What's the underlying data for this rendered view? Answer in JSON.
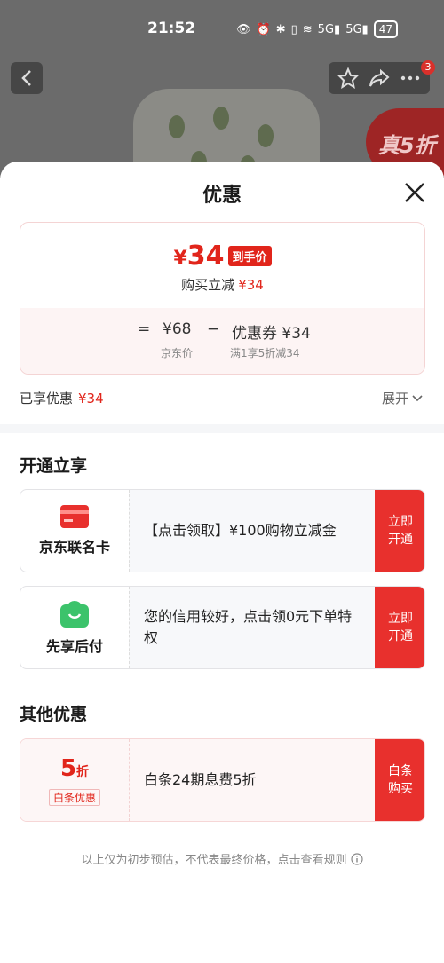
{
  "status_bar": {
    "time": "21:52",
    "battery": "47",
    "network_1": "5G",
    "network_2": "5G"
  },
  "background": {
    "cart_count": "3",
    "promo_tag": "真5折"
  },
  "sheet": {
    "title": "优惠",
    "price_card": {
      "yen": "¥",
      "final_price": "34",
      "final_tag": "到手价",
      "instant_reduce_label": "购买立减",
      "instant_reduce_value": "¥34",
      "equals": "=",
      "original_price": "¥68",
      "minus": "−",
      "coupon_label": "优惠券 ¥34",
      "original_caption": "京东价",
      "coupon_caption": "满1享5折减34"
    },
    "enjoyed_label": "已享优惠",
    "enjoyed_value": "¥34",
    "expand_label": "展开",
    "section_open": "开通立享",
    "section_other": "其他优惠",
    "offers": [
      {
        "left_label": "京东联名卡",
        "desc": "【点击领取】¥100购物立减金",
        "button": "立即\n开通",
        "icon": "credit-card-icon"
      },
      {
        "left_label": "先享后付",
        "desc": "您的信用较好，点击领0元下单特权",
        "button": "立即\n开通",
        "icon": "shopping-bag-icon"
      }
    ],
    "other_offer": {
      "discount_num": "5",
      "discount_unit": "折",
      "tag": "白条优惠",
      "desc": "白条24期息费5折",
      "button": "白条\n购买"
    },
    "footer_note": "以上仅为初步预估，不代表最终价格，点击查看规则"
  },
  "colors": {
    "accent": "#e1251b",
    "button": "#e8302d",
    "icon_green": "#3cc36b"
  }
}
